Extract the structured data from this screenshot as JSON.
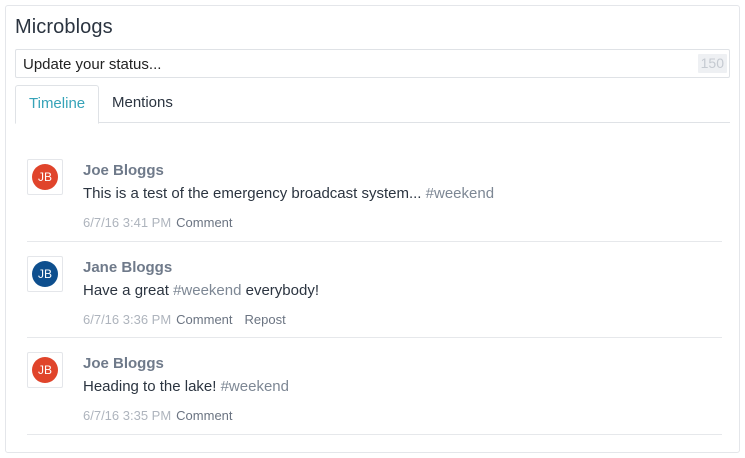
{
  "widget": {
    "title": "Microblogs",
    "status_placeholder": "Update your status...",
    "char_count": "150"
  },
  "tabs": [
    {
      "label": "Timeline",
      "active": true
    },
    {
      "label": "Mentions",
      "active": false
    }
  ],
  "colors": {
    "accent": "#36a3b8",
    "avatar_red": "#e0442b",
    "avatar_blue": "#0e4f8e"
  },
  "posts": [
    {
      "initials": "JB",
      "avatar_color": "#e0442b",
      "author": "Joe Bloggs",
      "text": "This is a test of the emergency broadcast system... ",
      "hashtag": "#weekend",
      "text_after": "",
      "time": "6/7/16 3:41 PM",
      "actions": [
        "Comment"
      ]
    },
    {
      "initials": "JB",
      "avatar_color": "#0e4f8e",
      "author": "Jane Bloggs",
      "text": "Have a great ",
      "hashtag": "#weekend",
      "text_after": " everybody!",
      "time": "6/7/16 3:36 PM",
      "actions": [
        "Comment",
        "Repost"
      ]
    },
    {
      "initials": "JB",
      "avatar_color": "#e0442b",
      "author": "Joe Bloggs",
      "text": "Heading to the lake! ",
      "hashtag": "#weekend",
      "text_after": "",
      "time": "6/7/16 3:35 PM",
      "actions": [
        "Comment"
      ]
    }
  ]
}
